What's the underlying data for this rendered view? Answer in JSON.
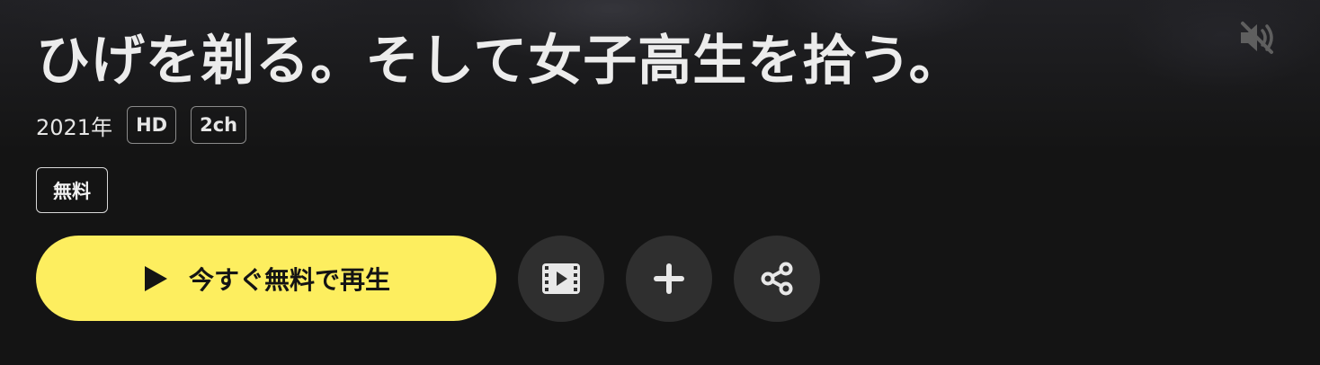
{
  "title": "ひげを剃る。そして女子高生を拾う。",
  "meta": {
    "year": "2021年",
    "tags": [
      "HD",
      "2ch"
    ]
  },
  "badges": {
    "free": "無料"
  },
  "actions": {
    "play_label": "今すぐ無料で再生"
  },
  "icons": {
    "mute": "speaker-muted-icon",
    "play": "play-icon",
    "trailer": "film-icon",
    "add": "plus-icon",
    "share": "share-icon"
  },
  "colors": {
    "accent": "#fdee5f",
    "background": "#141414",
    "circle_button": "#2f2f2f"
  }
}
